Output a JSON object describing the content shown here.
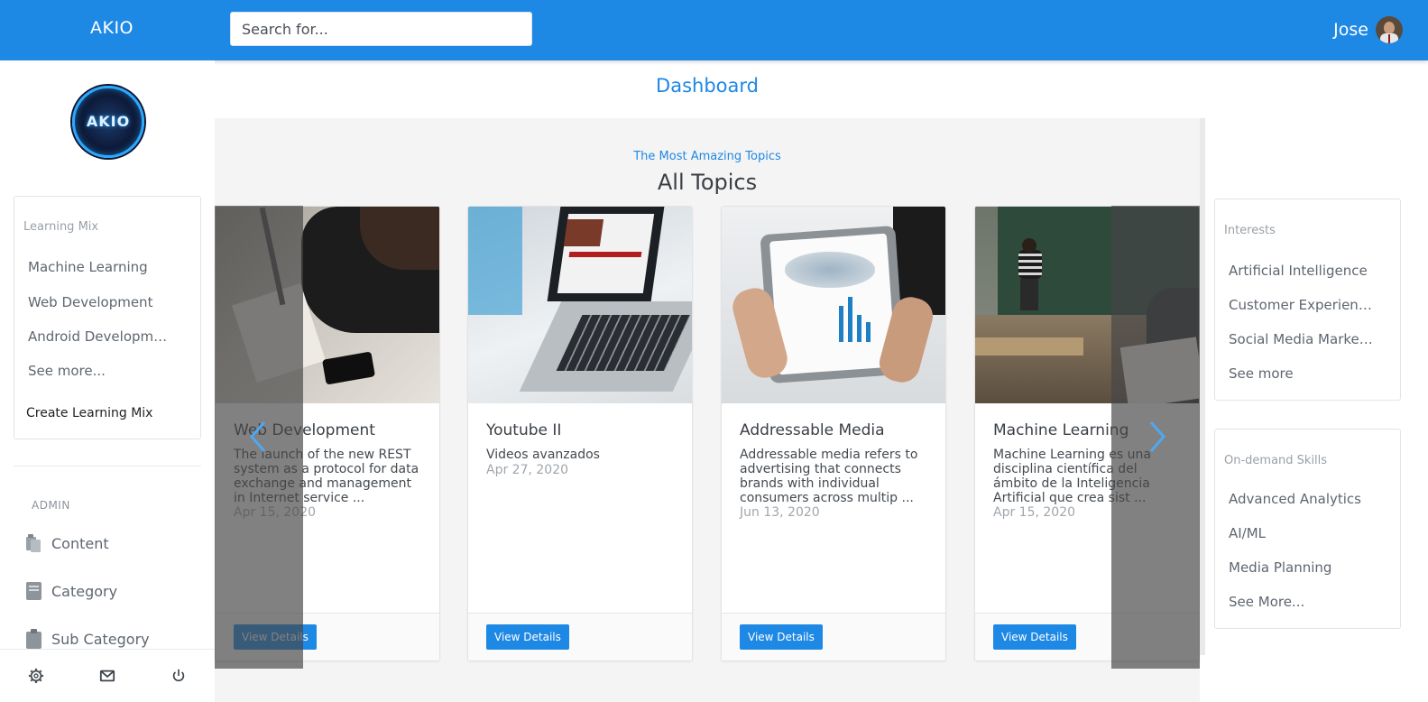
{
  "app": {
    "brand": "AKIO",
    "logo_text": "AKIO"
  },
  "search": {
    "placeholder": "Search for..."
  },
  "user": {
    "name": "Jose"
  },
  "page": {
    "title": "Dashboard"
  },
  "learning_mix": {
    "title": "Learning Mix",
    "items": [
      "Machine Learning",
      "Web Development",
      "Android Development",
      "See more..."
    ],
    "create_label": "Create Learning Mix"
  },
  "admin": {
    "label": "ADMIN",
    "items": [
      {
        "label": "Content",
        "icon": "files-icon"
      },
      {
        "label": "Category",
        "icon": "book-icon"
      },
      {
        "label": "Sub Category",
        "icon": "clipboard-icon"
      }
    ]
  },
  "footer_icons": [
    "gear-icon",
    "mail-icon",
    "power-icon"
  ],
  "topics": {
    "eyebrow": "The Most Amazing Topics",
    "title": "All Topics",
    "cards": [
      {
        "title": "Web Development",
        "description": "The launch of the new REST system as a protocol for data exchange and management in Internet service ...",
        "date": "Apr 15, 2020",
        "button": "View Details"
      },
      {
        "title": "Youtube II",
        "description": "Videos avanzados",
        "date": "Apr 27, 2020",
        "button": "View Details"
      },
      {
        "title": "Addressable Media",
        "description": "Addressable media refers to advertising that connects brands with individual consumers across multip ...",
        "date": "Jun 13, 2020",
        "button": "View Details"
      },
      {
        "title": "Machine Learning",
        "description": "Machine Learning es una disciplina científica del ámbito de la Inteligencia Artificial que crea sist ...",
        "date": "Apr 15, 2020",
        "button": "View Details"
      }
    ]
  },
  "interests": {
    "title": "Interests",
    "items": [
      "Artificial Intelligence",
      "Customer Experience",
      "Social Media Marketing",
      "See more"
    ]
  },
  "skills": {
    "title": "On-demand Skills",
    "items": [
      "Advanced Analytics",
      "AI/ML",
      "Media Planning",
      "See More..."
    ]
  },
  "colors": {
    "primary": "#1e88e5",
    "panel": "#f4f4f4"
  }
}
